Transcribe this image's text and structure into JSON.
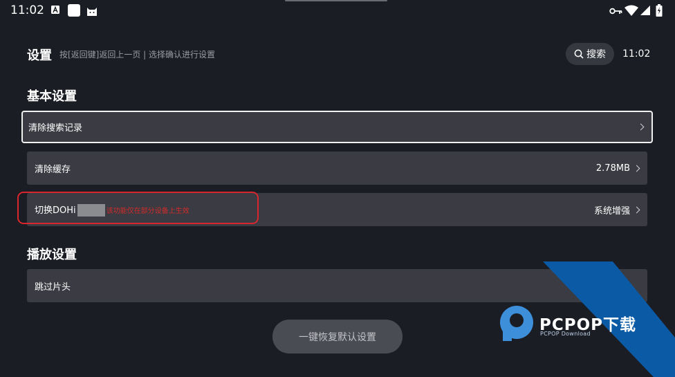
{
  "status_bar": {
    "time": "11:02"
  },
  "header": {
    "title": "设置",
    "hint": "按[返回键]返回上一页 | 选择确认进行设置",
    "search_label": "搜索",
    "clock": "11:02"
  },
  "sections": [
    {
      "title": "基本设置",
      "rows": [
        {
          "label": "清除搜索记录",
          "value": ""
        },
        {
          "label": "清除缓存",
          "value": "2.78MB"
        },
        {
          "label": "切换DOH",
          "label_suffix": "i",
          "note": "该功能仅在部分设备上生效",
          "value": "系统增强"
        }
      ]
    },
    {
      "title": "播放设置",
      "rows": [
        {
          "label": "跳过片头",
          "value": ""
        }
      ]
    }
  ],
  "reset_button": "一键恢复默认设置",
  "watermark": {
    "brand": "PCPOP下载",
    "sub": "PCPOP Download"
  },
  "colors": {
    "background": "#1b1d24",
    "row": "#3b3c43",
    "highlight": "#d9262c",
    "watermark_blue": "#0b5aa6"
  }
}
